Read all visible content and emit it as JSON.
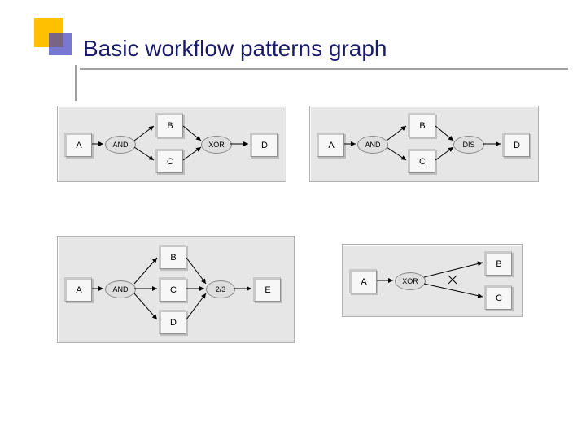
{
  "title": "Basic workflow patterns graph",
  "panels": {
    "p1": {
      "nodes": {
        "A": "A",
        "B": "B",
        "C": "C",
        "D": "D"
      },
      "gates": {
        "g1": "AND",
        "g2": "XOR"
      }
    },
    "p2": {
      "nodes": {
        "A": "A",
        "B": "B",
        "C": "C",
        "D": "D"
      },
      "gates": {
        "g1": "AND",
        "g2": "DIS"
      }
    },
    "p3": {
      "nodes": {
        "A": "A",
        "B": "B",
        "C": "C",
        "D": "D",
        "E": "E"
      },
      "gates": {
        "g1": "AND",
        "g2": "2/3"
      }
    },
    "p4": {
      "nodes": {
        "A": "A",
        "B": "B",
        "C": "C"
      },
      "gates": {
        "g1": "XOR"
      }
    }
  }
}
